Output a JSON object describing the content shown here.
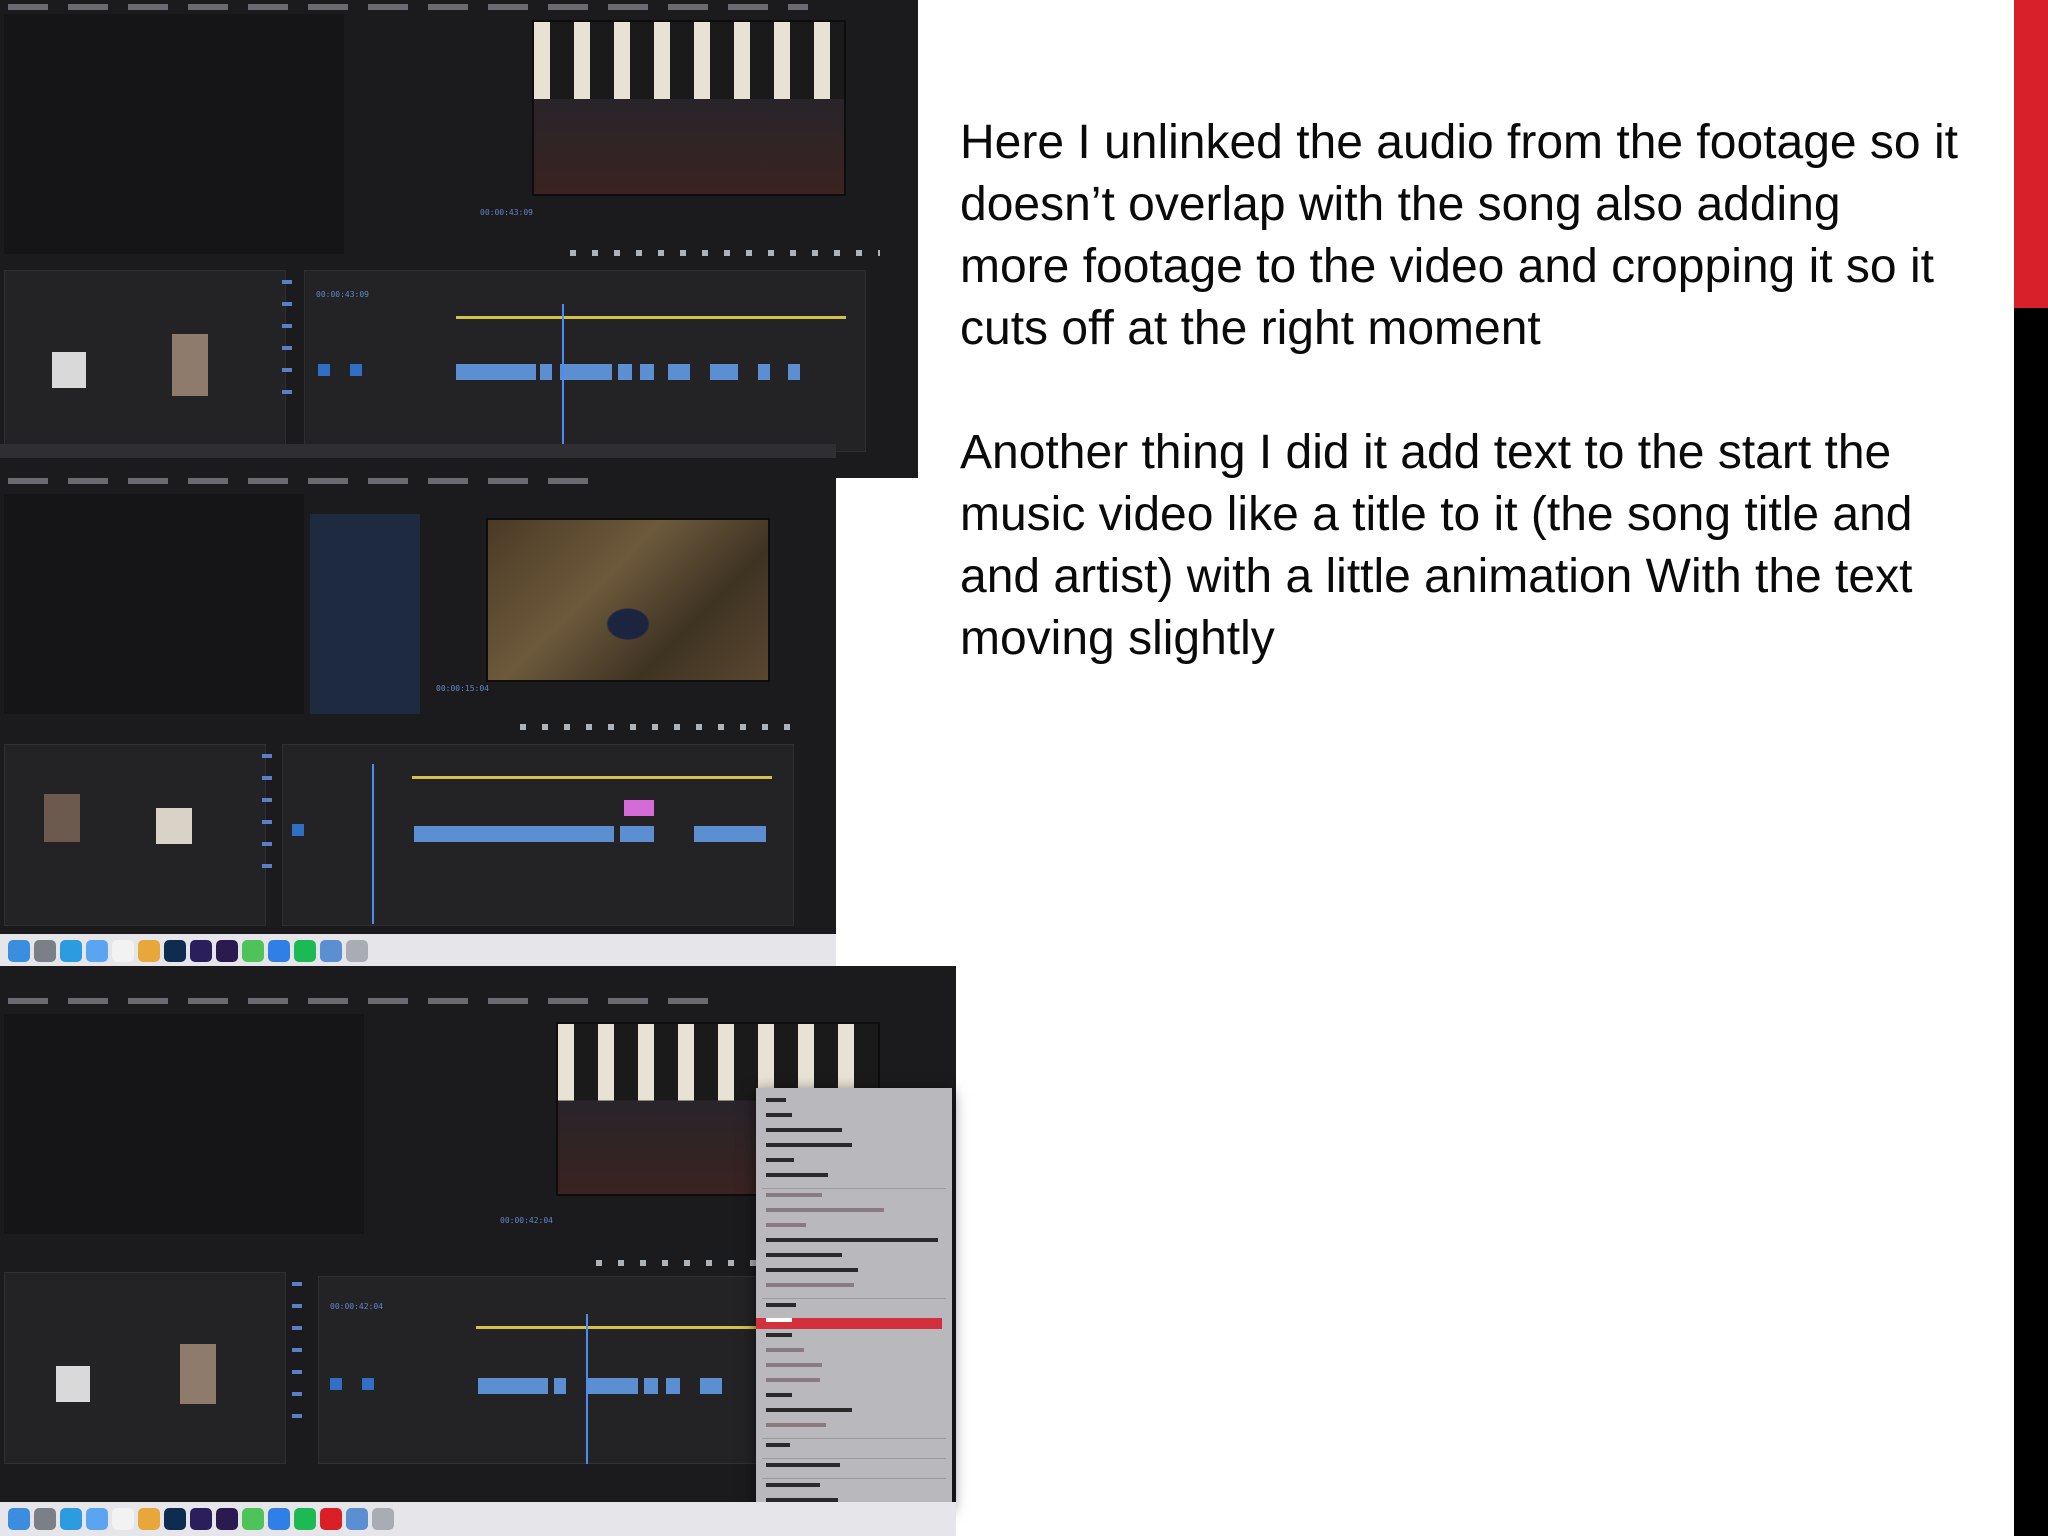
{
  "slide": {
    "paragraphs": [
      "Here I unlinked the audio from the footage so it doesn’t overlap with the song also adding more footage to the video and cropping it so it cuts off at the right moment",
      "Another thing I did it add text to the start the music video like a title to it (the song title and and artist) with a little animation With the text moving slightly"
    ]
  },
  "colors": {
    "accent_red": "#d8202a",
    "accent_black": "#000000",
    "premiere_dark": "#1b1b1e",
    "playhead_blue": "#4d8cf0",
    "clip_blue": "#5b8fd2",
    "menu_highlight": "#d3303d"
  },
  "screenshots": [
    {
      "name": "premiere-pro-unlinked-audio",
      "app": "Adobe Premiere Pro"
    },
    {
      "name": "premiere-pro-title-text",
      "app": "Adobe Premiere Pro"
    },
    {
      "name": "premiere-pro-context-menu",
      "app": "Adobe Premiere Pro"
    }
  ],
  "icons": [
    "finder-icon",
    "photoshop-icon",
    "after-effects-icon",
    "premiere-icon",
    "trash-icon"
  ]
}
